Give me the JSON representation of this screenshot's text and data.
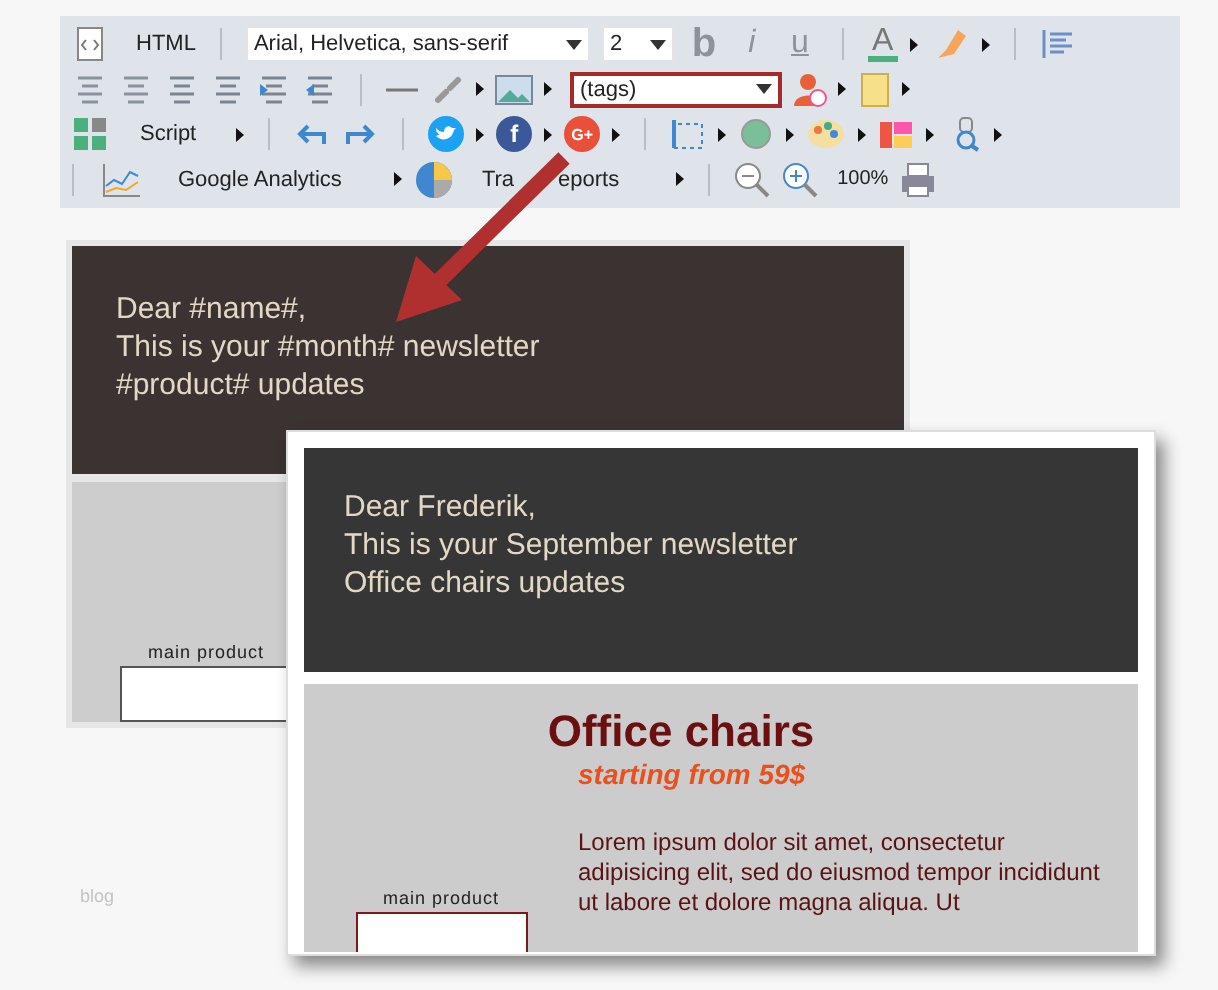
{
  "toolbar": {
    "html_label": "HTML",
    "font_select": "Arial, Helvetica, sans-serif",
    "size_select": "2",
    "bold_glyph": "b",
    "italic_glyph": "i",
    "underline_glyph": "u",
    "color_glyph": "A",
    "tags_select": {
      "value": "(tags)",
      "highlighted": true
    },
    "script_label": "Script",
    "facebook_glyph": "f",
    "google_glyph": "G+",
    "analytics_label": "Google Analytics",
    "reports_label_parts": [
      "Tra",
      "eports"
    ],
    "zoom_level": "100%"
  },
  "template_card": {
    "greeting_lines": [
      "Dear #name#,",
      "This is your #month# newsletter",
      "#product# updates"
    ],
    "product_label": "main product"
  },
  "preview_card": {
    "greeting_lines": [
      "Dear Frederik,",
      "This is your September newsletter",
      "Office chairs updates"
    ],
    "title": "Office chairs",
    "subtitle": "starting from 59$",
    "body": "Lorem ipsum dolor sit amet, consectetur adipisicing elit, sed do eiusmod tempor incididunt ut labore et dolore magna aliqua. Ut",
    "product_label": "main product"
  },
  "footer_text": "blog"
}
